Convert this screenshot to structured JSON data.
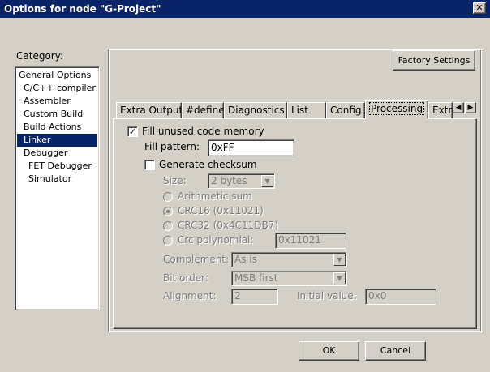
{
  "window": {
    "title": "Options for node \"G-Project\"",
    "close_glyph": "✕"
  },
  "category": {
    "label": "Category:",
    "items": [
      {
        "label": "General Options",
        "indent": 0
      },
      {
        "label": "C/C++ compiler",
        "indent": 1
      },
      {
        "label": "Assembler",
        "indent": 1
      },
      {
        "label": "Custom Build",
        "indent": 1
      },
      {
        "label": "Build Actions",
        "indent": 1
      },
      {
        "label": "Linker",
        "indent": 1,
        "selected": true
      },
      {
        "label": "Debugger",
        "indent": 1
      },
      {
        "label": "FET Debugger",
        "indent": 2
      },
      {
        "label": "Simulator",
        "indent": 2
      }
    ]
  },
  "factory_settings_label": "Factory Settings",
  "tabs": [
    "Extra Output",
    "#define",
    "Diagnostics",
    "List",
    "Config",
    "Processing",
    "Extra"
  ],
  "active_tab": "Processing",
  "tab_scroll": {
    "left": "◀",
    "right": "▶"
  },
  "processing": {
    "fill_unused": {
      "label": "Fill unused code memory",
      "checked": true,
      "check_glyph": "✓"
    },
    "fill_pattern": {
      "label": "Fill pattern:",
      "value": "0xFF"
    },
    "generate_checksum": {
      "label": "Generate checksum",
      "checked": false
    },
    "size": {
      "label": "Size:",
      "value": "2 bytes"
    },
    "radios": [
      {
        "label": "Arithmetic sum",
        "checked": false
      },
      {
        "label": "CRC16 (0x11021)",
        "checked": true
      },
      {
        "label": "CRC32 (0x4C11DB7)",
        "checked": false
      },
      {
        "label": "Crc polynomial:",
        "checked": false
      }
    ],
    "crc_polynomial_value": "0x11021",
    "complement": {
      "label": "Complement:",
      "value": "As is"
    },
    "bit_order": {
      "label": "Bit order:",
      "value": "MSB first"
    },
    "alignment": {
      "label": "Alignment:",
      "value": "2"
    },
    "initial_value": {
      "label": "Initial value:",
      "value": "0x0"
    }
  },
  "buttons": {
    "ok": "OK",
    "cancel": "Cancel"
  }
}
